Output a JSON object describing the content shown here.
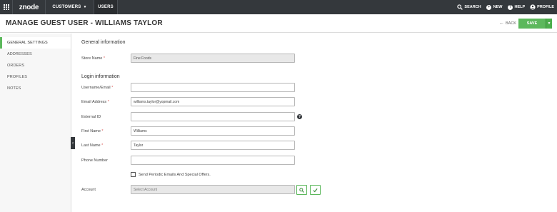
{
  "topnav": {
    "logo": "znode",
    "customers_label": "CUSTOMERS",
    "users_label": "USERS",
    "search_label": "SEARCH",
    "new_label": "NEW",
    "help_label": "HELP",
    "profile_label": "PROFILE"
  },
  "header": {
    "title": "MANAGE GUEST USER - WILLIAMS TAYLOR",
    "back_label": "BACK",
    "save_label": "SAVE"
  },
  "sidebar": {
    "items": [
      {
        "label": "GENERAL SETTINGS"
      },
      {
        "label": "ADDRESSES"
      },
      {
        "label": "ORDERS"
      },
      {
        "label": "PROFILES"
      },
      {
        "label": "NOTES"
      }
    ]
  },
  "form": {
    "general_heading": "General information",
    "store_label": "Store Name",
    "store_value": "Fine Foods",
    "login_heading": "Login information",
    "username_label": "Username/Email",
    "username_value": "",
    "email_label": "Email Address",
    "email_value": "williams.taylor@yopmail.com",
    "external_label": "External ID",
    "external_value": "",
    "first_label": "First Name",
    "first_value": "Williams",
    "last_label": "Last Name",
    "last_value": "Taylor",
    "phone_label": "Phone Number",
    "phone_value": "",
    "optin_label": "Send Periodic Emails And Special Offers.",
    "account_label": "Account",
    "account_placeholder": "Select Account",
    "required_mark": "*"
  },
  "colors": {
    "topbar": "#34383c",
    "accent_green": "#5cb85c",
    "required_red": "#d9534f"
  },
  "icons": [
    "grid-icon",
    "chevron-down-icon",
    "search-icon",
    "plus-circle-icon",
    "question-circle-icon",
    "user-circle-icon",
    "arrow-left-icon",
    "chevron-left-icon",
    "help-icon",
    "checkbox-icon",
    "check-icon"
  ]
}
